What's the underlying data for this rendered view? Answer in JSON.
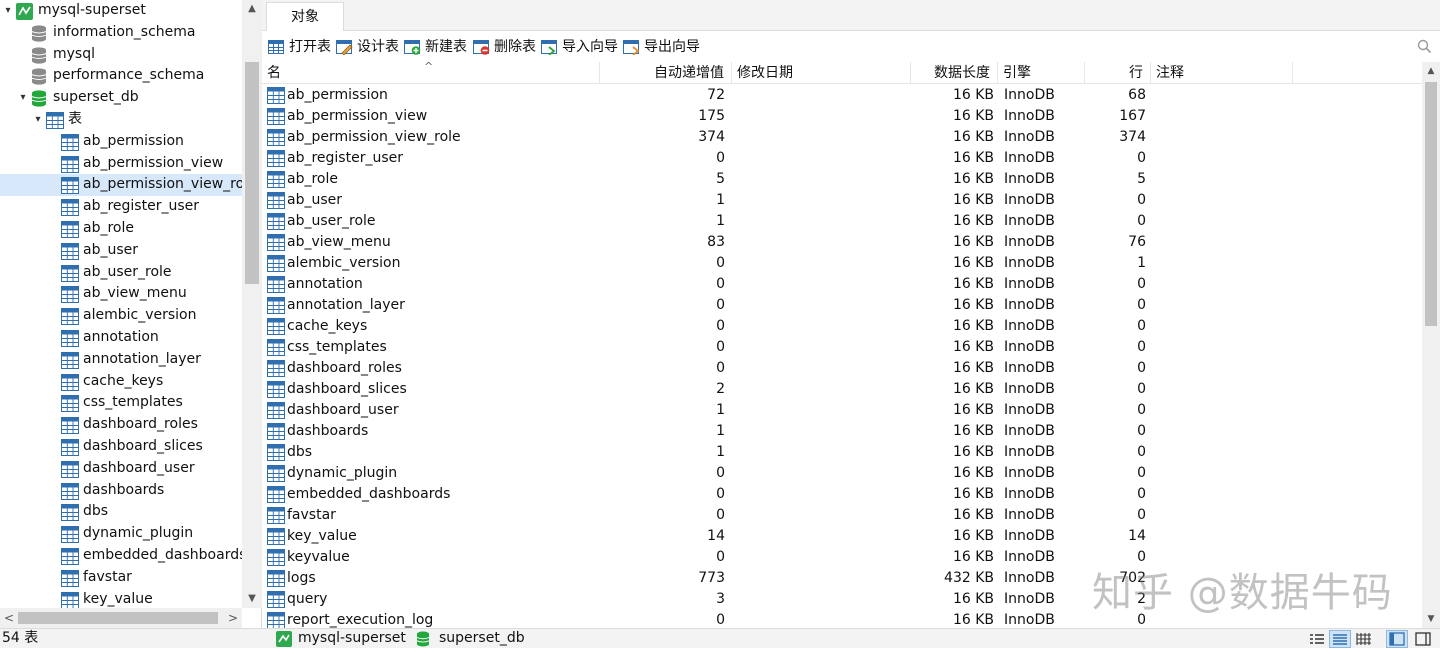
{
  "navigator": {
    "connection": "mysql-superset",
    "databases": [
      "information_schema",
      "mysql",
      "performance_schema",
      "superset_db"
    ],
    "tables_group": "表",
    "tables": [
      "ab_permission",
      "ab_permission_view",
      "ab_permission_view_role",
      "ab_register_user",
      "ab_role",
      "ab_user",
      "ab_user_role",
      "ab_view_menu",
      "alembic_version",
      "annotation",
      "annotation_layer",
      "cache_keys",
      "css_templates",
      "dashboard_roles",
      "dashboard_slices",
      "dashboard_user",
      "dashboards",
      "dbs",
      "dynamic_plugin",
      "embedded_dashboards",
      "favstar",
      "key_value"
    ],
    "selected_table": "ab_permission_view_role",
    "scroll_up": "▲",
    "scroll_down": "▼",
    "scroll_left": "<",
    "scroll_right": ">"
  },
  "tabs": {
    "objects": "对象"
  },
  "toolbar": {
    "open_table": "打开表",
    "design_table": "设计表",
    "new_table": "新建表",
    "delete_table": "删除表",
    "import_wizard": "导入向导",
    "export_wizard": "导出向导"
  },
  "columns": {
    "name": "名",
    "auto_increment": "自动递增值",
    "modified_date": "修改日期",
    "data_length": "数据长度",
    "engine": "引擎",
    "rows": "行",
    "comment": "注释"
  },
  "rows": [
    {
      "name": "ab_permission",
      "auto_inc": "72",
      "modified": "",
      "data_length": "16 KB",
      "engine": "InnoDB",
      "rows": "68"
    },
    {
      "name": "ab_permission_view",
      "auto_inc": "175",
      "modified": "",
      "data_length": "16 KB",
      "engine": "InnoDB",
      "rows": "167"
    },
    {
      "name": "ab_permission_view_role",
      "auto_inc": "374",
      "modified": "",
      "data_length": "16 KB",
      "engine": "InnoDB",
      "rows": "374"
    },
    {
      "name": "ab_register_user",
      "auto_inc": "0",
      "modified": "",
      "data_length": "16 KB",
      "engine": "InnoDB",
      "rows": "0"
    },
    {
      "name": "ab_role",
      "auto_inc": "5",
      "modified": "",
      "data_length": "16 KB",
      "engine": "InnoDB",
      "rows": "5"
    },
    {
      "name": "ab_user",
      "auto_inc": "1",
      "modified": "",
      "data_length": "16 KB",
      "engine": "InnoDB",
      "rows": "0"
    },
    {
      "name": "ab_user_role",
      "auto_inc": "1",
      "modified": "",
      "data_length": "16 KB",
      "engine": "InnoDB",
      "rows": "0"
    },
    {
      "name": "ab_view_menu",
      "auto_inc": "83",
      "modified": "",
      "data_length": "16 KB",
      "engine": "InnoDB",
      "rows": "76"
    },
    {
      "name": "alembic_version",
      "auto_inc": "0",
      "modified": "",
      "data_length": "16 KB",
      "engine": "InnoDB",
      "rows": "1"
    },
    {
      "name": "annotation",
      "auto_inc": "0",
      "modified": "",
      "data_length": "16 KB",
      "engine": "InnoDB",
      "rows": "0"
    },
    {
      "name": "annotation_layer",
      "auto_inc": "0",
      "modified": "",
      "data_length": "16 KB",
      "engine": "InnoDB",
      "rows": "0"
    },
    {
      "name": "cache_keys",
      "auto_inc": "0",
      "modified": "",
      "data_length": "16 KB",
      "engine": "InnoDB",
      "rows": "0"
    },
    {
      "name": "css_templates",
      "auto_inc": "0",
      "modified": "",
      "data_length": "16 KB",
      "engine": "InnoDB",
      "rows": "0"
    },
    {
      "name": "dashboard_roles",
      "auto_inc": "0",
      "modified": "",
      "data_length": "16 KB",
      "engine": "InnoDB",
      "rows": "0"
    },
    {
      "name": "dashboard_slices",
      "auto_inc": "2",
      "modified": "",
      "data_length": "16 KB",
      "engine": "InnoDB",
      "rows": "0"
    },
    {
      "name": "dashboard_user",
      "auto_inc": "1",
      "modified": "",
      "data_length": "16 KB",
      "engine": "InnoDB",
      "rows": "0"
    },
    {
      "name": "dashboards",
      "auto_inc": "1",
      "modified": "",
      "data_length": "16 KB",
      "engine": "InnoDB",
      "rows": "0"
    },
    {
      "name": "dbs",
      "auto_inc": "1",
      "modified": "",
      "data_length": "16 KB",
      "engine": "InnoDB",
      "rows": "0"
    },
    {
      "name": "dynamic_plugin",
      "auto_inc": "0",
      "modified": "",
      "data_length": "16 KB",
      "engine": "InnoDB",
      "rows": "0"
    },
    {
      "name": "embedded_dashboards",
      "auto_inc": "0",
      "modified": "",
      "data_length": "16 KB",
      "engine": "InnoDB",
      "rows": "0"
    },
    {
      "name": "favstar",
      "auto_inc": "0",
      "modified": "",
      "data_length": "16 KB",
      "engine": "InnoDB",
      "rows": "0"
    },
    {
      "name": "key_value",
      "auto_inc": "14",
      "modified": "",
      "data_length": "16 KB",
      "engine": "InnoDB",
      "rows": "14"
    },
    {
      "name": "keyvalue",
      "auto_inc": "0",
      "modified": "",
      "data_length": "16 KB",
      "engine": "InnoDB",
      "rows": "0"
    },
    {
      "name": "logs",
      "auto_inc": "773",
      "modified": "",
      "data_length": "432 KB",
      "engine": "InnoDB",
      "rows": "702"
    },
    {
      "name": "query",
      "auto_inc": "3",
      "modified": "",
      "data_length": "16 KB",
      "engine": "InnoDB",
      "rows": "2"
    },
    {
      "name": "report_execution_log",
      "auto_inc": "0",
      "modified": "",
      "data_length": "16 KB",
      "engine": "InnoDB",
      "rows": "0"
    }
  ],
  "status": {
    "count": "54 表",
    "connection": "mysql-superset",
    "database": "superset_db"
  },
  "watermark": "知乎 @数据牛码",
  "colors": {
    "selection": "#d6e8fa",
    "db_active": "#22a83a",
    "db_inactive": "#8a8a8a",
    "table_icon": "#2f6fb0",
    "connection": "#2fa84f"
  }
}
